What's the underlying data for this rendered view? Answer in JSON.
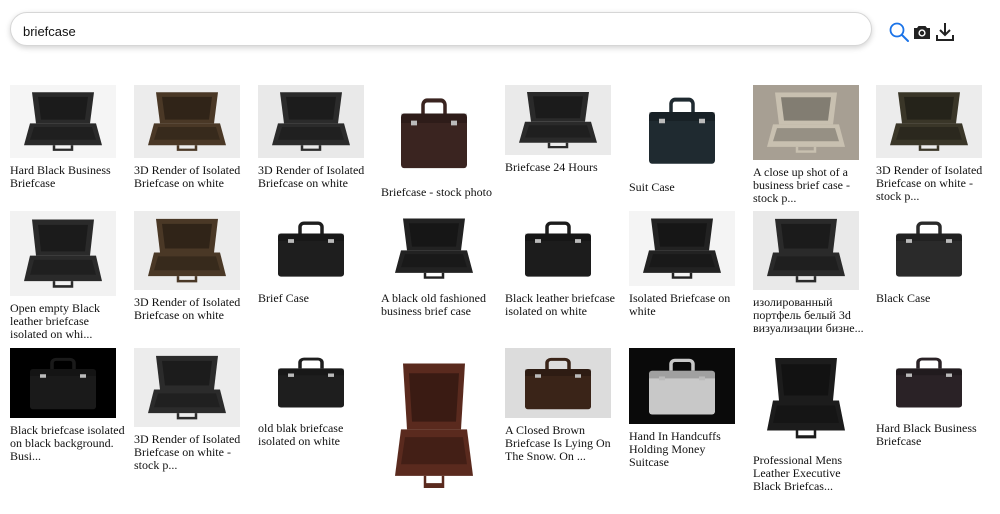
{
  "search": {
    "query": "briefcase",
    "placeholder": ""
  },
  "icons": {
    "search": "search-icon",
    "camera": "camera-icon",
    "download": "download-icon"
  },
  "results": [
    {
      "caption": "Hard Black Business Briefcase",
      "tone": "#2a2a2a",
      "bg": "#f5f5f5",
      "open": true
    },
    {
      "caption": "3D Render of Isolated Briefcase on white",
      "tone": "#4a3826",
      "bg": "#ececec",
      "open": true
    },
    {
      "caption": "3D Render of Isolated Briefcase on white",
      "tone": "#2b2b2b",
      "bg": "#e9e9e9",
      "open": true
    },
    {
      "caption": "Briefcase - stock photo",
      "tone": "#3a2420",
      "bg": "#ffffff",
      "open": false
    },
    {
      "caption": "Briefcase 24 Hours",
      "tone": "#2a2a2a",
      "bg": "#eaeaea",
      "open": true
    },
    {
      "caption": "Suit Case",
      "tone": "#1f2a30",
      "bg": "#ffffff",
      "open": false
    },
    {
      "caption": "A close up shot of a business brief case - stock p...",
      "tone": "#c8c0b0",
      "bg": "#a79f93",
      "open": true
    },
    {
      "caption": "3D Render of Isolated Briefcase on white - stock p...",
      "tone": "#3a3628",
      "bg": "#ececec",
      "open": true
    },
    {
      "caption": "Open empty Black leather briefcase isolated on whi...",
      "tone": "#2a2a2a",
      "bg": "#f2f2f2",
      "open": true
    },
    {
      "caption": "3D Render of Isolated Briefcase on white",
      "tone": "#4a3826",
      "bg": "#ececec",
      "open": true
    },
    {
      "caption": "Brief Case",
      "tone": "#1e1e1e",
      "bg": "#ffffff",
      "open": false
    },
    {
      "caption": "A black old fashioned business brief case",
      "tone": "#222222",
      "bg": "#ffffff",
      "open": true
    },
    {
      "caption": "Black leather briefcase isolated on white",
      "tone": "#1c1c1c",
      "bg": "#ffffff",
      "open": false
    },
    {
      "caption": "Isolated Briefcase on white",
      "tone": "#222222",
      "bg": "#f4f4f4",
      "open": true
    },
    {
      "caption": "изолированный портфель белый 3d визуализации бизне...",
      "tone": "#2a2a2a",
      "bg": "#e9e9e9",
      "open": true
    },
    {
      "caption": "Black Case",
      "tone": "#2a2a2a",
      "bg": "#ffffff",
      "open": false
    },
    {
      "caption": "Black briefcase isolated on black background. Busi...",
      "tone": "#1a1a1a",
      "bg": "#000000",
      "open": false
    },
    {
      "caption": "3D Render of Isolated Briefcase on white - stock p...",
      "tone": "#2b2b2b",
      "bg": "#ececec",
      "open": true
    },
    {
      "caption": "old blak briefcase isolated on white",
      "tone": "#1e1e1e",
      "bg": "#ffffff",
      "open": false
    },
    {
      "caption": "",
      "tone": "#5a2a1e",
      "bg": "#ffffff",
      "open": true
    },
    {
      "caption": "A Closed Brown Briefcase Is Lying On The Snow. On ...",
      "tone": "#3a2418",
      "bg": "#dcdcdc",
      "open": false
    },
    {
      "caption": "Hand In Handcuffs Holding Money Suitcase",
      "tone": "#c8c8c8",
      "bg": "#0a0a0a",
      "open": false
    },
    {
      "caption": "Professional Mens Leather Executive Black Briefcas...",
      "tone": "#1c1c1c",
      "bg": "#ffffff",
      "open": true
    },
    {
      "caption": "Hard Black Business Briefcase",
      "tone": "#2a2226",
      "bg": "#ffffff",
      "open": false
    }
  ]
}
